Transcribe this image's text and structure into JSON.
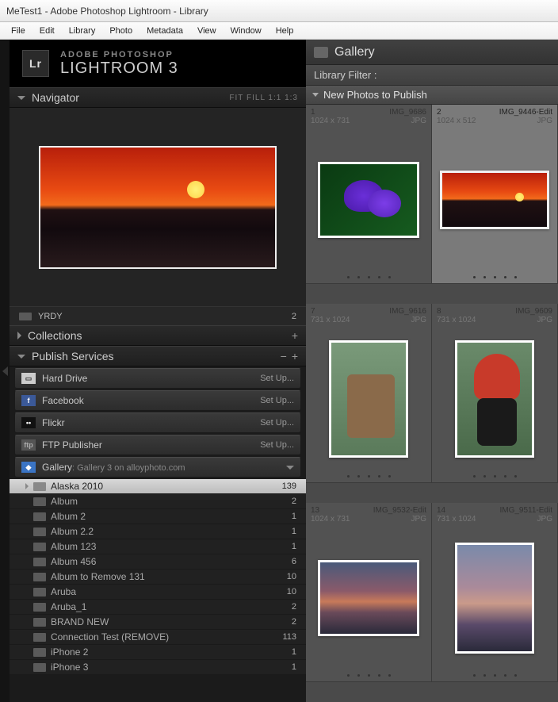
{
  "window": {
    "title": "MeTest1 - Adobe Photoshop Lightroom - Library"
  },
  "menu": [
    "File",
    "Edit",
    "Library",
    "Photo",
    "Metadata",
    "View",
    "Window",
    "Help"
  ],
  "brand": {
    "line1": "ADOBE PHOTOSHOP",
    "line2": "LIGHTROOM 3",
    "badge": "Lr"
  },
  "panels": {
    "navigator": {
      "title": "Navigator",
      "opts": "FIT  FILL  1:1  1:3"
    },
    "folder": {
      "name": "YRDY",
      "count": "2"
    },
    "collections": {
      "title": "Collections"
    },
    "publish": {
      "title": "Publish Services"
    }
  },
  "services": [
    {
      "name": "Hard Drive",
      "action": "Set Up...",
      "iconBg": "#ccc",
      "iconFg": "#333",
      "iconTxt": "▭"
    },
    {
      "name": "Facebook",
      "action": "Set Up...",
      "iconBg": "#3b5998",
      "iconFg": "#fff",
      "iconTxt": "f"
    },
    {
      "name": "Flickr",
      "action": "Set Up...",
      "iconBg": "#111",
      "iconFg": "#fff",
      "iconTxt": "••"
    },
    {
      "name": "FTP Publisher",
      "action": "Set Up...",
      "iconBg": "#555",
      "iconFg": "#aaa",
      "iconTxt": "ftp"
    },
    {
      "name": "Gallery",
      "sub": ":  Gallery 3 on alloyphoto.com",
      "iconBg": "#3a74c4",
      "iconFg": "#fff",
      "iconTxt": "◆",
      "expanded": true
    }
  ],
  "tree": [
    {
      "name": "Alaska 2010",
      "count": "139",
      "selected": true,
      "expandable": true
    },
    {
      "name": "Album",
      "count": "2"
    },
    {
      "name": "Album 2",
      "count": "1"
    },
    {
      "name": "Album 2.2",
      "count": "1"
    },
    {
      "name": "Album 123",
      "count": "1"
    },
    {
      "name": "Album 456",
      "count": "6"
    },
    {
      "name": "Album to Remove 131",
      "count": "10"
    },
    {
      "name": "Aruba",
      "count": "10"
    },
    {
      "name": "Aruba_1",
      "count": "2"
    },
    {
      "name": "BRAND NEW",
      "count": "2"
    },
    {
      "name": "Connection Test (REMOVE)",
      "count": "113"
    },
    {
      "name": "iPhone 2",
      "count": "1"
    },
    {
      "name": "iPhone 3",
      "count": "1"
    }
  ],
  "gallery": {
    "title": "Gallery",
    "filter": "Library Filter :",
    "section": "New Photos to Publish"
  },
  "thumbs": [
    {
      "idx": "1",
      "name": "IMG_9686",
      "dim": "1024 x 731",
      "fmt": "JPG",
      "cls": "th-flower"
    },
    {
      "idx": "2",
      "name": "IMG_9446-Edit",
      "dim": "1024 x 512",
      "fmt": "JPG",
      "cls": "th-sunset",
      "selected": true
    },
    {
      "idx": "7",
      "name": "IMG_9616",
      "dim": "731 x 1024",
      "fmt": "JPG",
      "cls": "th-totem1"
    },
    {
      "idx": "8",
      "name": "IMG_9609",
      "dim": "731 x 1024",
      "fmt": "JPG",
      "cls": "th-totem2"
    },
    {
      "idx": "13",
      "name": "IMG_9532-Edit",
      "dim": "1024 x 731",
      "fmt": "JPG",
      "cls": "th-sky1"
    },
    {
      "idx": "14",
      "name": "IMG_9511-Edit",
      "dim": "731 x 1024",
      "fmt": "JPG",
      "cls": "th-sky2"
    }
  ]
}
